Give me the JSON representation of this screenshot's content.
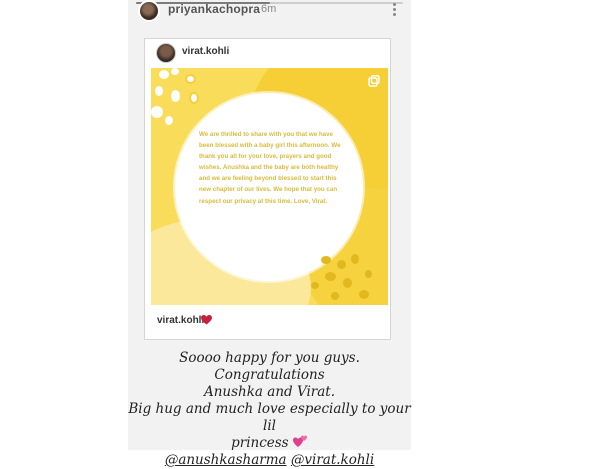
{
  "story": {
    "username": "priyankachopra",
    "time": "6m",
    "progress_fraction": 0.5
  },
  "shared_post": {
    "username": "virat.kohli",
    "message": "We are thrilled to share with you that we have been blessed with a baby girl this afternoon. We thank you all for your love, prayers and good wishes. Anushka and the baby are both healthy and we are feeling beyond blessed to start this new chapter of our lives. We hope that you can respect our privacy at this time. Love, Virat.",
    "footer_username": "virat.kohli"
  },
  "caption": {
    "line1": "Soooo happy for you guys. Congratulations",
    "line2": "Anushka and Virat.",
    "line3": "Big hug and much love especially to your lil",
    "line4": "princess",
    "mention1": "@anushkasharma",
    "mention2": "@virat.kohli"
  },
  "icons": [
    "more-vertical-icon",
    "heart-icon",
    "pink-hearts-icon",
    "copy-icon"
  ],
  "colors": {
    "post_yellow": "#f9dd5a",
    "post_yellow_dark": "#f6cf36",
    "post_text": "#d8bb3e",
    "heart": "#c8203a",
    "pink_heart": "#e0408a"
  }
}
